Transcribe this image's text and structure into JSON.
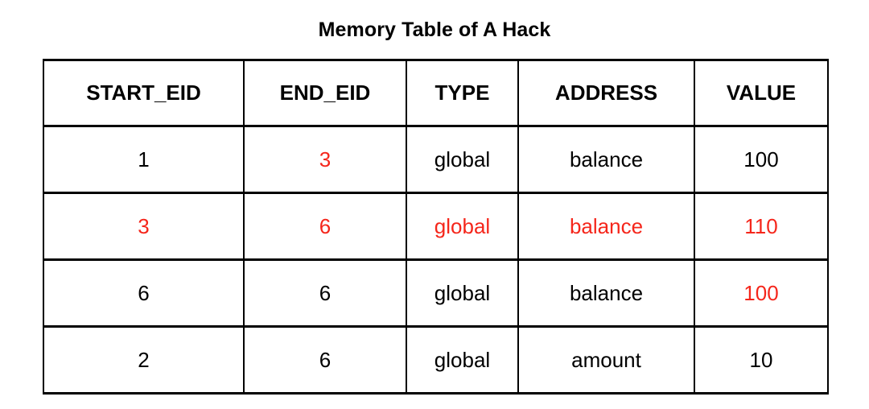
{
  "title": "Memory Table of A Hack",
  "colors": {
    "highlight": "#f5261b",
    "text": "#000000",
    "background": "#ffffff",
    "border": "#000000"
  },
  "table": {
    "columns": [
      {
        "label": "START_EID"
      },
      {
        "label": "END_EID"
      },
      {
        "label": "TYPE"
      },
      {
        "label": "ADDRESS"
      },
      {
        "label": "VALUE"
      }
    ],
    "rows": [
      {
        "cells": [
          {
            "text": "1",
            "color": "black"
          },
          {
            "text": "3",
            "color": "red"
          },
          {
            "text": "global",
            "color": "black"
          },
          {
            "text": "balance",
            "color": "black"
          },
          {
            "text": "100",
            "color": "black"
          }
        ]
      },
      {
        "cells": [
          {
            "text": "3",
            "color": "red"
          },
          {
            "text": "6",
            "color": "red"
          },
          {
            "text": "global",
            "color": "red"
          },
          {
            "text": "balance",
            "color": "red"
          },
          {
            "text": "110",
            "color": "red"
          }
        ]
      },
      {
        "cells": [
          {
            "text": "6",
            "color": "black"
          },
          {
            "text": "6",
            "color": "black"
          },
          {
            "text": "global",
            "color": "black"
          },
          {
            "text": "balance",
            "color": "black"
          },
          {
            "text": "100",
            "color": "red"
          }
        ]
      },
      {
        "cells": [
          {
            "text": "2",
            "color": "black"
          },
          {
            "text": "6",
            "color": "black"
          },
          {
            "text": "global",
            "color": "black"
          },
          {
            "text": "amount",
            "color": "black"
          },
          {
            "text": "10",
            "color": "black"
          }
        ]
      }
    ]
  }
}
